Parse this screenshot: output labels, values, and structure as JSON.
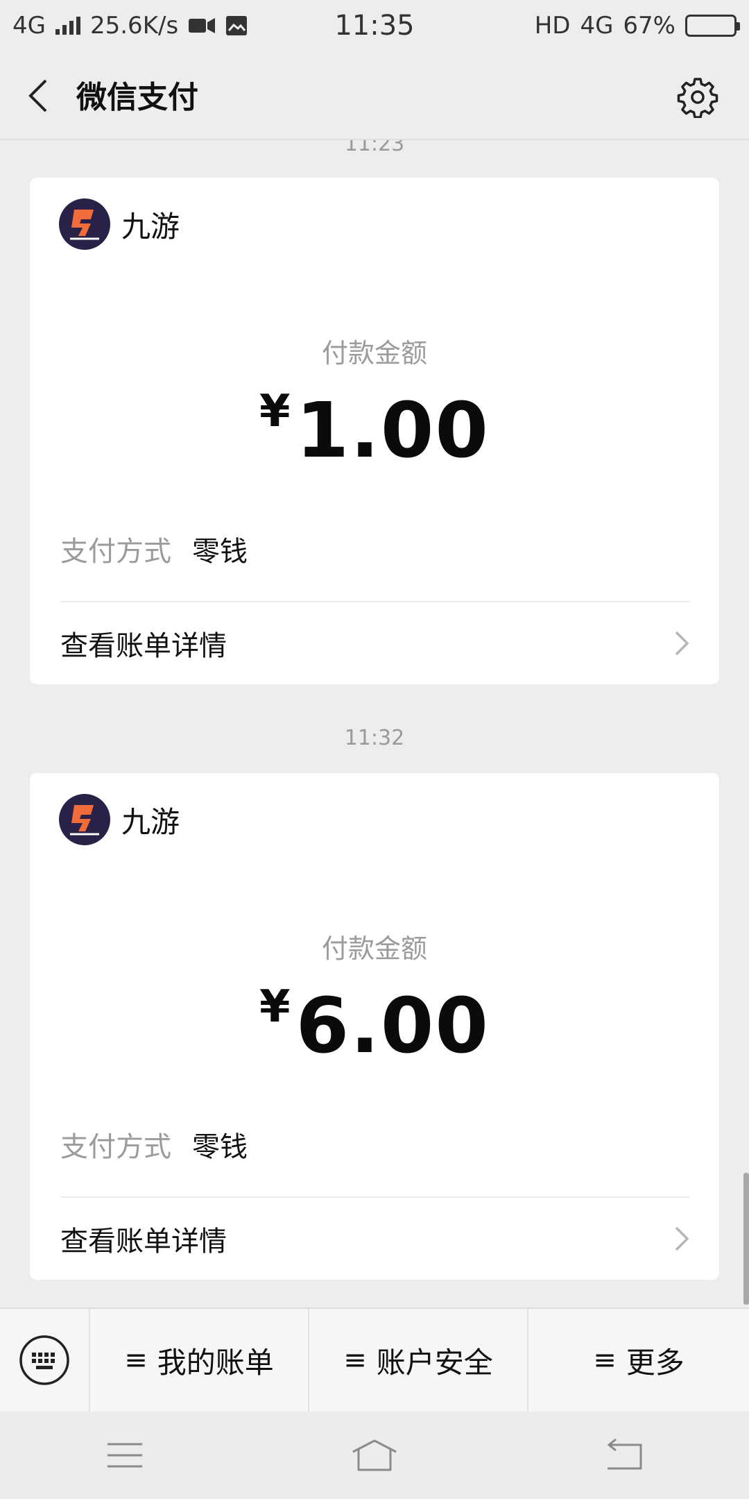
{
  "status_bar": {
    "network_left": "4G",
    "speed": "25.6K/s",
    "time": "11:35",
    "hd": "HD",
    "network_right": "4G",
    "battery": "67%",
    "battery_level": 0.67
  },
  "nav": {
    "title": "微信支付",
    "back_icon": "chevron-left-icon",
    "settings_icon": "gear-icon"
  },
  "messages": [
    {
      "time": "11:23",
      "merchant": "九游",
      "amount_label": "付款金额",
      "currency": "¥",
      "amount": "1.00",
      "pay_method_label": "支付方式",
      "pay_method": "零钱",
      "detail_link": "查看账单详情"
    },
    {
      "time": "11:32",
      "merchant": "九游",
      "amount_label": "付款金额",
      "currency": "¥",
      "amount": "6.00",
      "pay_method_label": "支付方式",
      "pay_method": "零钱",
      "detail_link": "查看账单详情"
    }
  ],
  "bottom_menu": {
    "keyboard_icon": "keyboard-icon",
    "items": [
      {
        "label": "我的账单"
      },
      {
        "label": "账户安全"
      },
      {
        "label": "更多"
      }
    ]
  },
  "colors": {
    "background": "#ededed",
    "card": "#ffffff",
    "muted_text": "#9b9b9b",
    "logo_bg": "#2a2148",
    "logo_accent": "#f26b3a"
  }
}
